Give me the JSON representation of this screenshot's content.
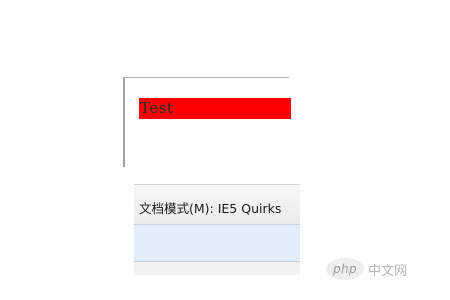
{
  "preview": {
    "test_text": "Test",
    "highlight_color": "#ff0000"
  },
  "devtools": {
    "document_mode_label": "文档模式(M): IE5 Quirks"
  },
  "watermark": {
    "logo_text": "php",
    "site_name": "中文网"
  }
}
